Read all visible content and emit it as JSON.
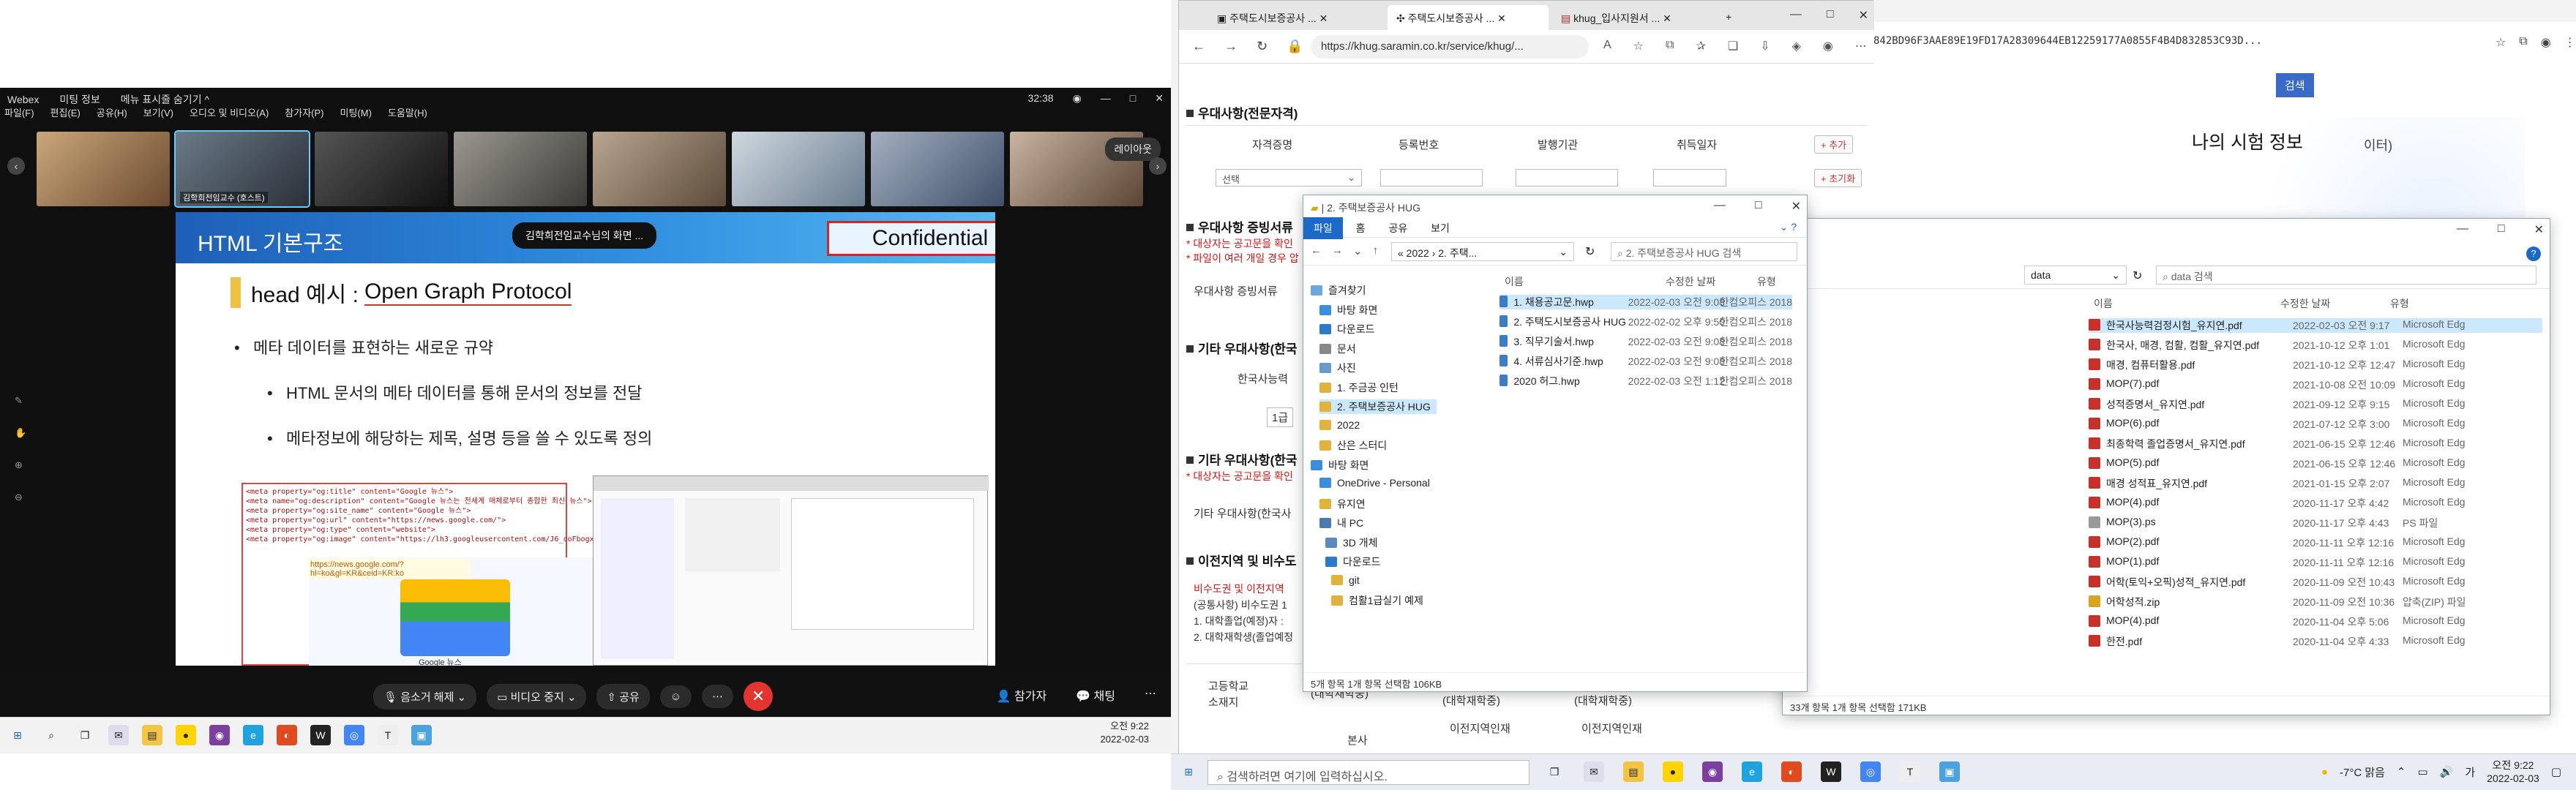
{
  "webex": {
    "app_name": "Webex",
    "meeting_info": "미팅 정보",
    "hide_label": "메뉴 표시줄 숨기기 ^",
    "timer": "32:38",
    "menu": [
      "파일(F)",
      "편집(E)",
      "공유(H)",
      "보기(V)",
      "오디오 및 비디오(A)",
      "참가자(P)",
      "미팅(M)",
      "도움말(H)"
    ],
    "participants": [
      {
        "name": ""
      },
      {
        "name": "김학희전임교수 (호스트)"
      },
      {
        "name": ""
      },
      {
        "name": ""
      },
      {
        "name": ""
      },
      {
        "name": ""
      },
      {
        "name": ""
      },
      {
        "name": ""
      }
    ],
    "layout_btn": "레이아웃",
    "slide": {
      "header": "HTML 기본구조",
      "sharing": "김학희전임교수님의 화면 ...",
      "confidential": "Confidential",
      "heading_prefix": "head 예시 :",
      "heading_link": "Open Graph Protocol",
      "b1": "메타 데이터를 표현하는 새로운 규약",
      "b2": "HTML 문서의 메타 데이터를 통해 문서의 정보를 전달",
      "b3": "메타정보에 해당하는 제목, 설명 등을 쓸 수 있도록 정의",
      "code": [
        "<meta property=\"og:title\" content=\"Google 뉴스\">",
        "<meta name=\"og:description\" content=\"Google 뉴스는 전세계 매체로부터 종합한 최신 뉴스\">",
        "<meta property=\"og:site_name\" content=\"Google 뉴스\">",
        "<meta property=\"og:url\" content=\"https://news.google.com/\">",
        "<meta property=\"og:type\" content=\"website\">",
        "<meta property=\"og:image\" content=\"https://lh3.googleusercontent.com/J6_coFbogx...\">"
      ],
      "code_link": "https://news.google.com/?hl=ko&gl=KR&ceid=KR:ko",
      "code_caption": "Google 뉴스"
    },
    "controls": {
      "mute": "음소거 해제",
      "video": "비디오 중지",
      "share": "공유"
    },
    "right": {
      "participants": "참가자",
      "chat": "채팅"
    }
  },
  "taskbar_left": {
    "time": "오전 9:22",
    "date": "2022-02-03"
  },
  "browser": {
    "tabs": [
      "주택도시보증공사 ...",
      "주택도시보증공사 ...",
      "khug_입사지원서 ..."
    ],
    "url": "https://khug.saramin.co.kr/service/khug/...",
    "form": {
      "s1": "우대사항(전문자격)",
      "th": [
        "자격증명",
        "등록번호",
        "발행기관",
        "취득일자"
      ],
      "add": "+ 추가",
      "init": "+ 초기화",
      "select": "선택",
      "s2": "우대사항 증빙서류",
      "note1": "* 대상자는 공고문을 확인",
      "note2": "* 파일이 여러 개일 경우 압",
      "s2_row": "우대사항 증빙서류",
      "s3": "기타 우대사항(한국",
      "s3_row": "한국사능력",
      "s3_grade": "1급",
      "s4": "기타 우대사항(한국",
      "s4_note": "* 대상자는 공고문을 확인",
      "s4_row": "기타 우대사항(한국사",
      "s5": "이전지역 및 비수도",
      "s5_note1": "비수도권 및 이전지역",
      "s5_note2": "(공통사항) 비수도권 1",
      "s5_note3": "1. 대학졸업(예정)자 :",
      "s5_note4": "2. 대학재학생(졸업예정",
      "bottom": [
        "고등학교",
        "소재지",
        "(대학재학중)",
        "(대학재학중)",
        "(대학재학중)",
        "이전지역인재",
        "이전지역인재",
        "본사"
      ]
    }
  },
  "explorer1": {
    "title": "2. 주택보증공사 HUG",
    "ribbon": [
      "파일",
      "홈",
      "공유",
      "보기"
    ],
    "path": "« 2022 › 2. 주택...",
    "search": "2. 주택보증공사 HUG 검색",
    "headers": [
      "이름",
      "수정한 날짜",
      "유형"
    ],
    "nav": [
      "즐겨찾기",
      "바탕 화면",
      "다운로드",
      "문서",
      "사진",
      "1. 주금공 인턴",
      "2. 주택보증공사 HUG",
      "2022",
      "산은 스터디",
      "바탕 화면",
      "OneDrive - Personal",
      "유지연",
      "내 PC",
      "3D 개체",
      "다운로드",
      "git",
      "컴활1급실기 예제"
    ],
    "files": [
      {
        "name": "1. 채용공고문.hwp",
        "date": "2022-02-03 오전 9:08",
        "type": "한컴오피스 2018"
      },
      {
        "name": "2. 주택도시보증공사 HUG .hwp",
        "date": "2022-02-02 오후 9:50",
        "type": "한컴오피스 2018"
      },
      {
        "name": "3. 직무기술서.hwp",
        "date": "2022-02-03 오전 9:08",
        "type": "한컴오피스 2018"
      },
      {
        "name": "4. 서류심사기준.hwp",
        "date": "2022-02-03 오전 9:08",
        "type": "한컴오피스 2018"
      },
      {
        "name": "2020 허그.hwp",
        "date": "2022-02-03 오전 1:12",
        "type": "한컴오피스 2018"
      }
    ],
    "status": "5개 항목     1개 항목 선택함 106KB"
  },
  "explorer2": {
    "path": "data",
    "search": "data 검색",
    "headers": [
      "이름",
      "수정한 날짜",
      "유형"
    ],
    "files": [
      {
        "name": "한국사능력검정시험_유지연.pdf",
        "date": "2022-02-03 오전 9:17",
        "type": "Microsoft Edg"
      },
      {
        "name": "한국사, 매경, 컴활, 컴활_유지연.pdf",
        "date": "2021-10-12 오후 1:01",
        "type": "Microsoft Edg"
      },
      {
        "name": "매경, 컴퓨터활용.pdf",
        "date": "2021-10-12 오후 12:47",
        "type": "Microsoft Edg"
      },
      {
        "name": "MOP(7).pdf",
        "date": "2021-10-08 오전 10:09",
        "type": "Microsoft Edg"
      },
      {
        "name": "성적증명서_유지연.pdf",
        "date": "2021-09-12 오후 9:15",
        "type": "Microsoft Edg"
      },
      {
        "name": "MOP(6).pdf",
        "date": "2021-07-12 오후 3:00",
        "type": "Microsoft Edg"
      },
      {
        "name": "최종학력 졸업증명서_유지연.pdf",
        "date": "2021-06-15 오후 12:46",
        "type": "Microsoft Edg"
      },
      {
        "name": "MOP(5).pdf",
        "date": "2021-06-15 오후 12:46",
        "type": "Microsoft Edg"
      },
      {
        "name": "매경 성적표_유지연.pdf",
        "date": "2021-01-15 오후 2:07",
        "type": "Microsoft Edg"
      },
      {
        "name": "MOP(4).pdf",
        "date": "2020-11-17 오후 4:42",
        "type": "Microsoft Edg"
      },
      {
        "name": "MOP(3).ps",
        "date": "2020-11-17 오후 4:43",
        "type": "PS 파일"
      },
      {
        "name": "MOP(2).pdf",
        "date": "2020-11-11 오후 12:16",
        "type": "Microsoft Edg"
      },
      {
        "name": "MOP(1).pdf",
        "date": "2020-11-11 오후 12:16",
        "type": "Microsoft Edg"
      },
      {
        "name": "어학(토익+오픽)성적_유지연.pdf",
        "date": "2020-11-09 오전 10:43",
        "type": "Microsoft Edg"
      },
      {
        "name": "어학성적.zip",
        "date": "2020-11-09 오전 10:36",
        "type": "압축(ZIP) 파일"
      },
      {
        "name": "MOP(4).pdf",
        "date": "2020-11-04 오후 5:06",
        "type": "Microsoft Edg"
      },
      {
        "name": "한전.pdf",
        "date": "2020-11-04 오후 4:33",
        "type": "Microsoft Edg"
      }
    ],
    "status": "33개 항목    1개 항목 선택함 171KB"
  },
  "background": {
    "hash": "842BD96F3AAE89E19FD17A28309644EB12259177A0855F4B4D832853C93D...",
    "search": "검색",
    "title": "나의 시험 정보",
    "note": "이터)"
  },
  "taskbar_right": {
    "search_placeholder": "검색하려면 여기에 입력하십시오.",
    "weather": "-7°C 맑음",
    "lang": "가",
    "time": "오전 9:22",
    "date": "2022-02-03"
  }
}
